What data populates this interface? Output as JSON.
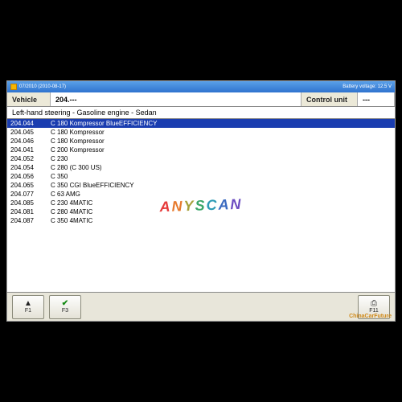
{
  "titlebar": {
    "version": "07/2010 (2010-08-17)",
    "battery": "Battery voltage: 12.5 V"
  },
  "header": {
    "vehicle_label": "Vehicle",
    "vehicle_value": "204.---",
    "cu_label": "Control unit",
    "cu_value": "---"
  },
  "breadcrumb": "Left-hand steering - Gasoline engine - Sedan",
  "rows": [
    {
      "code": "204.044",
      "desc": "C 180 Kompressor BlueEFFICIENCY",
      "sel": true
    },
    {
      "code": "204.045",
      "desc": "C 180 Kompressor"
    },
    {
      "code": "204.046",
      "desc": "C 180 Kompressor"
    },
    {
      "code": "204.041",
      "desc": "C 200 Kompressor"
    },
    {
      "code": "204.052",
      "desc": "C 230"
    },
    {
      "code": "204.054",
      "desc": "C 280 (C 300 US)"
    },
    {
      "code": "204.056",
      "desc": "C 350"
    },
    {
      "code": "204.065",
      "desc": "C 350 CGI BlueEFFICIENCY"
    },
    {
      "code": "204.077",
      "desc": "C 63 AMG"
    },
    {
      "code": "204.085",
      "desc": "C 230 4MATIC"
    },
    {
      "code": "204.081",
      "desc": "C 280 4MATIC"
    },
    {
      "code": "204.087",
      "desc": "C 350 4MATIC"
    }
  ],
  "buttons": {
    "f1": "F1",
    "f3": "F3",
    "f11": "F11"
  },
  "watermark": "ANYSCAN",
  "brand": "ChinaCarFuture"
}
